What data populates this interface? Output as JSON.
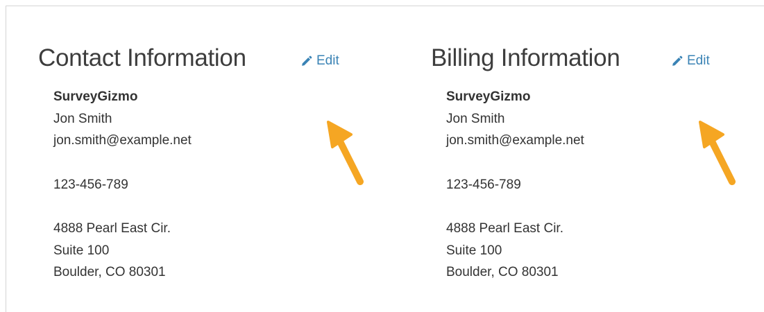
{
  "contact": {
    "title": "Contact Information",
    "edit_label": "Edit",
    "company": "SurveyGizmo",
    "name": "Jon Smith",
    "email": "jon.smith@example.net",
    "phone": "123-456-789",
    "address_line1": "4888 Pearl East Cir.",
    "address_line2": "Suite 100",
    "address_line3": "Boulder, CO 80301"
  },
  "billing": {
    "title": "Billing Information",
    "edit_label": "Edit",
    "company": "SurveyGizmo",
    "name": "Jon Smith",
    "email": "jon.smith@example.net",
    "phone": "123-456-789",
    "address_line1": "4888 Pearl East Cir.",
    "address_line2": "Suite 100",
    "address_line3": "Boulder, CO 80301"
  },
  "icons": {
    "edit": "pencil-icon",
    "annotation": "arrow-icon"
  },
  "colors": {
    "link": "#3a83b5",
    "heading": "#3d3d3d",
    "text": "#333333",
    "annotation_arrow": "#f5a623"
  }
}
